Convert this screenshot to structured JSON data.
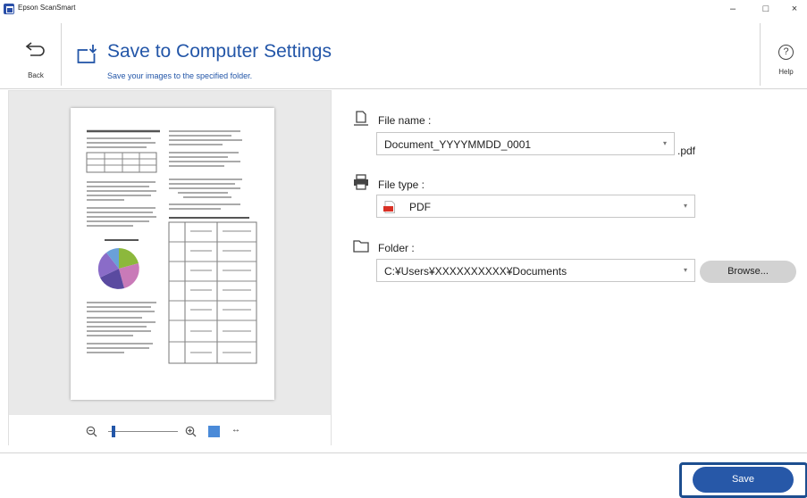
{
  "window": {
    "title": "Epson ScanSmart",
    "minimize": "–",
    "maximize": "□",
    "close": "×"
  },
  "header": {
    "back_label": "Back",
    "title": "Save to Computer Settings",
    "subtitle": "Save your images to the specified folder.",
    "help_label": "Help",
    "help_glyph": "?"
  },
  "form": {
    "file_name": {
      "label": "File name :",
      "value": "Document_YYYYMMDD_0001",
      "extension": ".pdf"
    },
    "file_type": {
      "label": "File type :",
      "value": "PDF"
    },
    "folder": {
      "label": "Folder :",
      "value": "C:¥Users¥XXXXXXXXXX¥Documents",
      "browse_label": "Browse..."
    }
  },
  "preview": {
    "zoom_level": 0.05,
    "fit_width_glyph": "↔"
  },
  "footer": {
    "save_label": "Save"
  },
  "colors": {
    "accent": "#2356a8",
    "save_button": "#2758a8",
    "focus_ring": "#1d4e8f",
    "pdf_icon": "#d93025"
  }
}
